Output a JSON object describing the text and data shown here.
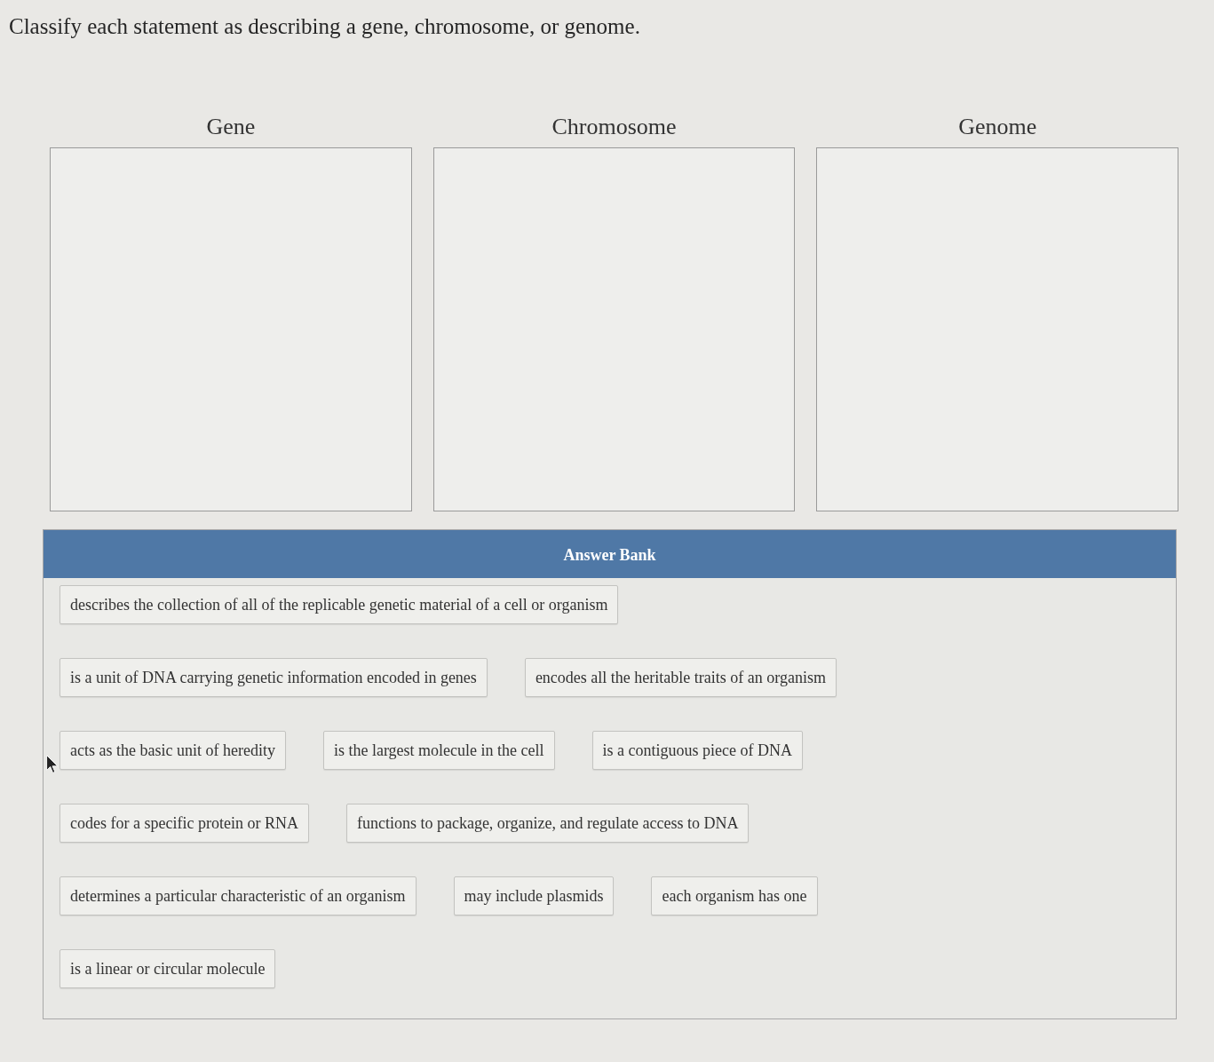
{
  "prompt": "Classify each statement as describing a gene, chromosome, or genome.",
  "categories": [
    {
      "label": "Gene"
    },
    {
      "label": "Chromosome"
    },
    {
      "label": "Genome"
    }
  ],
  "answer_bank": {
    "title": "Answer Bank",
    "rows": [
      {
        "items": [
          "describes the collection of all of the replicable genetic material of a cell or organism"
        ]
      },
      {
        "items": [
          "is a unit of DNA carrying genetic information encoded in genes",
          "encodes all the heritable traits of an organism"
        ]
      },
      {
        "items": [
          "acts as the basic unit of heredity",
          "is the largest molecule in the cell",
          "is a contiguous piece of DNA"
        ]
      },
      {
        "items": [
          "codes for a specific protein or RNA",
          "functions to package, organize, and regulate access to DNA"
        ]
      },
      {
        "items": [
          "determines a particular characteristic of an organism",
          "may include plasmids",
          "each organism has one"
        ]
      },
      {
        "items": [
          "is a linear or circular molecule"
        ]
      }
    ]
  }
}
